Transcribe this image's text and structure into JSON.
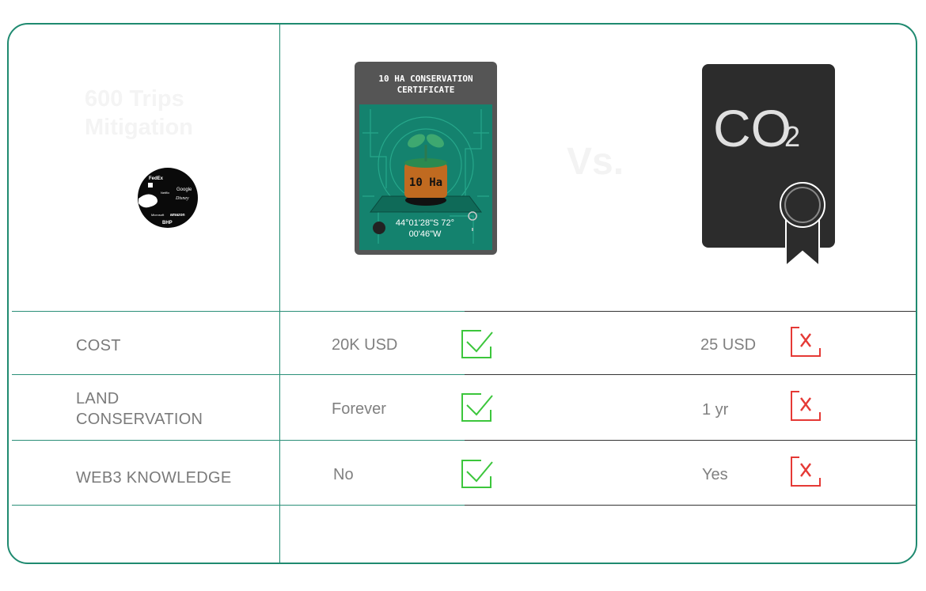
{
  "heading": "600 Trips Mitigation",
  "vs_label": "Vs.",
  "certificate": {
    "title_line1": "10 HA CONSERVATION",
    "title_line2": "CERTIFICATE",
    "area_label": "10 Ha",
    "coords_line1": "44°01'28\"S 72°",
    "coords_line2": "00'46\"W"
  },
  "co2_card": {
    "symbol": "CO",
    "subscript": "2"
  },
  "logos": [
    "FedEx",
    "Netflix",
    "Google",
    "Disney",
    "Microsoft",
    "amazon",
    "BHP"
  ],
  "rows": [
    {
      "label": "COST",
      "left_value": "20K USD",
      "right_value": "25 USD",
      "left_status": "check",
      "right_status": "x"
    },
    {
      "label_line1": "LAND",
      "label_line2": "CONSERVATION",
      "left_value": "Forever",
      "right_value": "1 yr",
      "left_status": "check",
      "right_status": "x"
    },
    {
      "label": "WEB3 KNOWLEDGE",
      "left_value": "No",
      "right_value": "Yes",
      "left_status": "check",
      "right_status": "x"
    }
  ],
  "colors": {
    "border": "#1f8a70",
    "check": "#3cc63c",
    "cross": "#e53935",
    "co2_card": "#2c2c2c"
  }
}
